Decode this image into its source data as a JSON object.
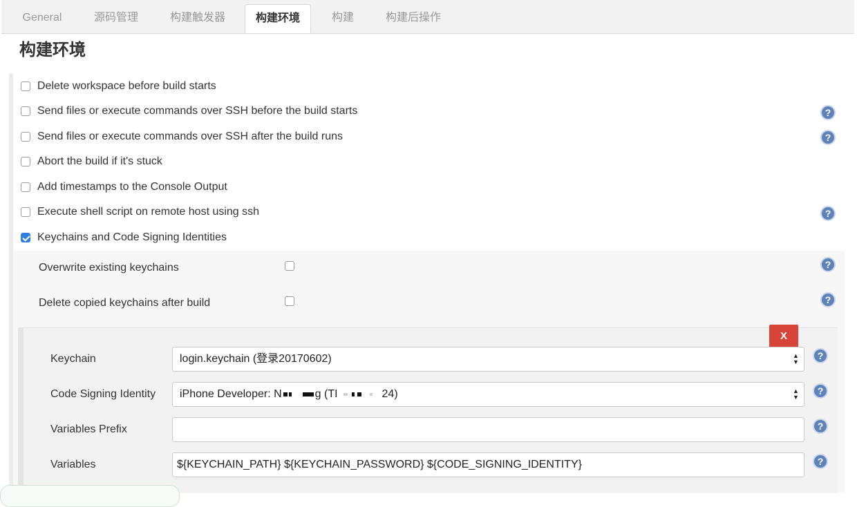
{
  "tabs": [
    {
      "label": "General",
      "active": false
    },
    {
      "label": "源码管理",
      "active": false
    },
    {
      "label": "构建触发器",
      "active": false
    },
    {
      "label": "构建环境",
      "active": true
    },
    {
      "label": "构建",
      "active": false
    },
    {
      "label": "构建后操作",
      "active": false
    }
  ],
  "section_title": "构建环境",
  "options": [
    {
      "label": "Delete workspace before build starts",
      "checked": false,
      "help": false
    },
    {
      "label": "Send files or execute commands over SSH before the build starts",
      "checked": false,
      "help": true
    },
    {
      "label": "Send files or execute commands over SSH after the build runs",
      "checked": false,
      "help": true
    },
    {
      "label": "Abort the build if it's stuck",
      "checked": false,
      "help": false
    },
    {
      "label": "Add timestamps to the Console Output",
      "checked": false,
      "help": false
    },
    {
      "label": "Execute shell script on remote host using ssh",
      "checked": false,
      "help": true
    },
    {
      "label": "Keychains and Code Signing Identities",
      "checked": true,
      "help": false
    }
  ],
  "keychain_options": {
    "overwrite_label": "Overwrite existing keychains",
    "overwrite_checked": false,
    "delete_copied_label": "Delete copied keychains after build",
    "delete_copied_checked": false
  },
  "identity_block": {
    "delete_label": "X",
    "keychain_label": "Keychain",
    "keychain_value": "login.keychain (登录20170602)",
    "code_signing_label": "Code Signing Identity",
    "code_signing_prefix": "iPhone Developer: N",
    "code_signing_mid": "g (TI",
    "code_signing_suffix": "24)",
    "variables_prefix_label": "Variables Prefix",
    "variables_prefix_value": "",
    "variables_label": "Variables",
    "variables_value": "${KEYCHAIN_PATH} ${KEYCHAIN_PASSWORD} ${CODE_SIGNING_IDENTITY}"
  },
  "icons": {
    "help": "help-icon",
    "checkbox_checked_color": "#2f7ee4",
    "delete_color": "#d9443a"
  }
}
